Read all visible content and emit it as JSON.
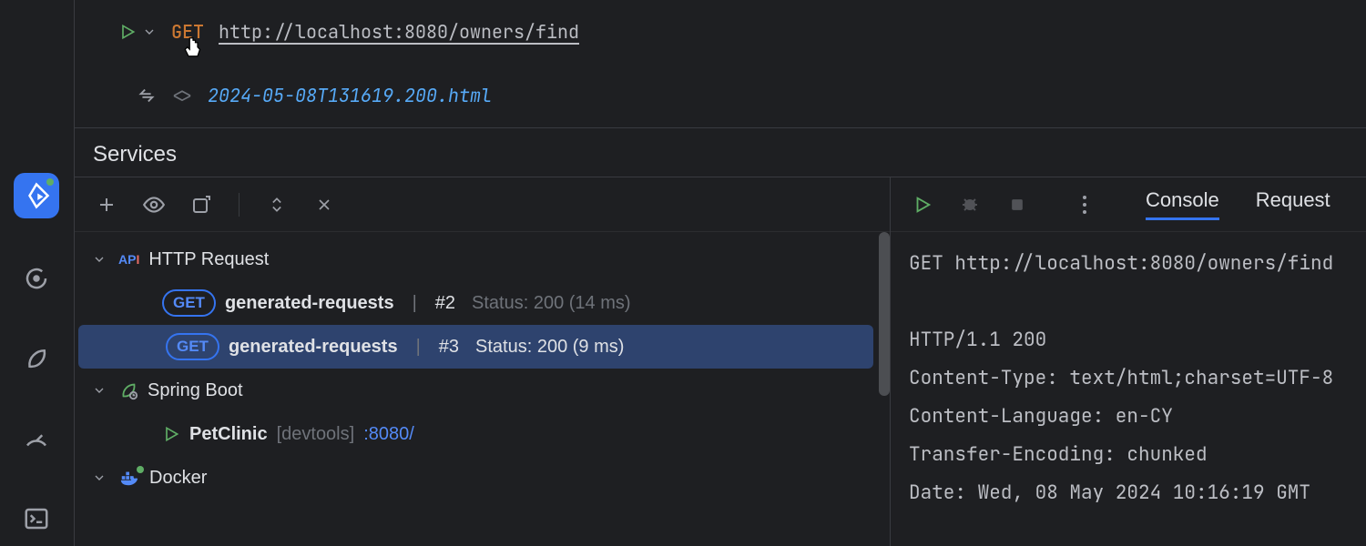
{
  "editor": {
    "method": "GET",
    "url": "http://localhost:8080/owners/find",
    "response_file": "2024-05-08T131619.200.html"
  },
  "services": {
    "title": "Services",
    "http_node": "HTTP Request",
    "spring_node": "Spring Boot",
    "docker_node": "Docker",
    "app_name": "PetClinic",
    "app_tag": "[devtools]",
    "app_port": ":8080/",
    "badge": "GET",
    "requests": [
      {
        "name": "generated-requests",
        "run": "#2",
        "status": "Status: 200 (14 ms)",
        "selected": false
      },
      {
        "name": "generated-requests",
        "run": "#3",
        "status": "Status: 200 (9 ms)",
        "selected": true
      }
    ]
  },
  "right": {
    "tabs": {
      "console": "Console",
      "request": "Request"
    },
    "console_lines": {
      "l0": "GET http://localhost:8080/owners/find",
      "l1": "",
      "l2": "HTTP/1.1 200 ",
      "l3": "Content-Type: text/html;charset=UTF-8",
      "l4": "Content-Language: en-CY",
      "l5": "Transfer-Encoding: chunked",
      "l6": "Date: Wed, 08 May 2024 10:16:19 GMT"
    }
  }
}
